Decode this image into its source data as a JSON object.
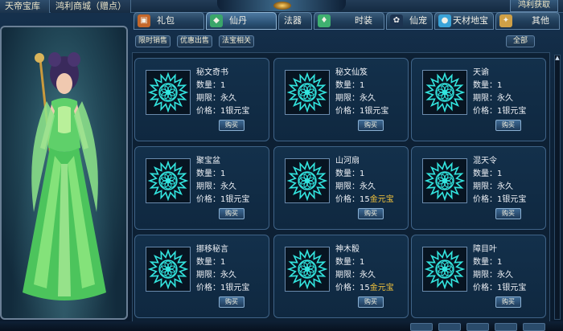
{
  "top": {
    "tab1": "天帝宝库",
    "tab2": "鸿利商城（赠点）",
    "right_button": "鸿利获取"
  },
  "categories": [
    {
      "label": "礼包",
      "icon": "gift-bag-icon",
      "color": "#c4672a"
    },
    {
      "label": "仙丹",
      "icon": "pill-bottle-icon",
      "color": "#3aa66a"
    },
    {
      "label": "法器",
      "icon": "magic-tool-icon",
      "color": "#6b8fc7"
    },
    {
      "label": "时装",
      "icon": "costume-icon",
      "color": "#3fb070"
    },
    {
      "label": "仙宠",
      "icon": "rabbit-pet-icon",
      "color": "#d8d8d8"
    },
    {
      "label": "天材地宝",
      "icon": "treasure-orb-icon",
      "color": "#3aa3d8"
    },
    {
      "label": "其他",
      "icon": "misc-icon",
      "color": "#cfa046"
    }
  ],
  "subfilters": [
    "限时销售",
    "优惠出售",
    "法宝相关"
  ],
  "all_button": "全部",
  "labels": {
    "qty": "数量：",
    "period": "期限：",
    "price": "价格：",
    "buy": "购买"
  },
  "items": [
    {
      "name": "秘文奇书",
      "qty": "1",
      "period": "永久",
      "price": "1",
      "unit": "银元宝",
      "unit_color": "silver"
    },
    {
      "name": "秘文仙笈",
      "qty": "1",
      "period": "永久",
      "price": "1",
      "unit": "银元宝",
      "unit_color": "silver"
    },
    {
      "name": "天谕",
      "qty": "1",
      "period": "永久",
      "price": "1",
      "unit": "银元宝",
      "unit_color": "silver"
    },
    {
      "name": "聚宝盆",
      "qty": "1",
      "period": "永久",
      "price": "1",
      "unit": "银元宝",
      "unit_color": "silver"
    },
    {
      "name": "山河扇",
      "qty": "1",
      "period": "永久",
      "price": "15",
      "unit": "金元宝",
      "unit_color": "gold"
    },
    {
      "name": "混天令",
      "qty": "1",
      "period": "永久",
      "price": "1",
      "unit": "银元宝",
      "unit_color": "silver"
    },
    {
      "name": "挪移秘言",
      "qty": "1",
      "period": "永久",
      "price": "1",
      "unit": "银元宝",
      "unit_color": "silver"
    },
    {
      "name": "神木骰",
      "qty": "1",
      "period": "永久",
      "price": "15",
      "unit": "金元宝",
      "unit_color": "gold"
    },
    {
      "name": "障目叶",
      "qty": "1",
      "period": "永久",
      "price": "1",
      "unit": "银元宝",
      "unit_color": "silver"
    }
  ],
  "colors": {
    "accent_cyan": "#33e6e0",
    "gold": "#f4c43b",
    "panel_bg": "#13304b"
  }
}
